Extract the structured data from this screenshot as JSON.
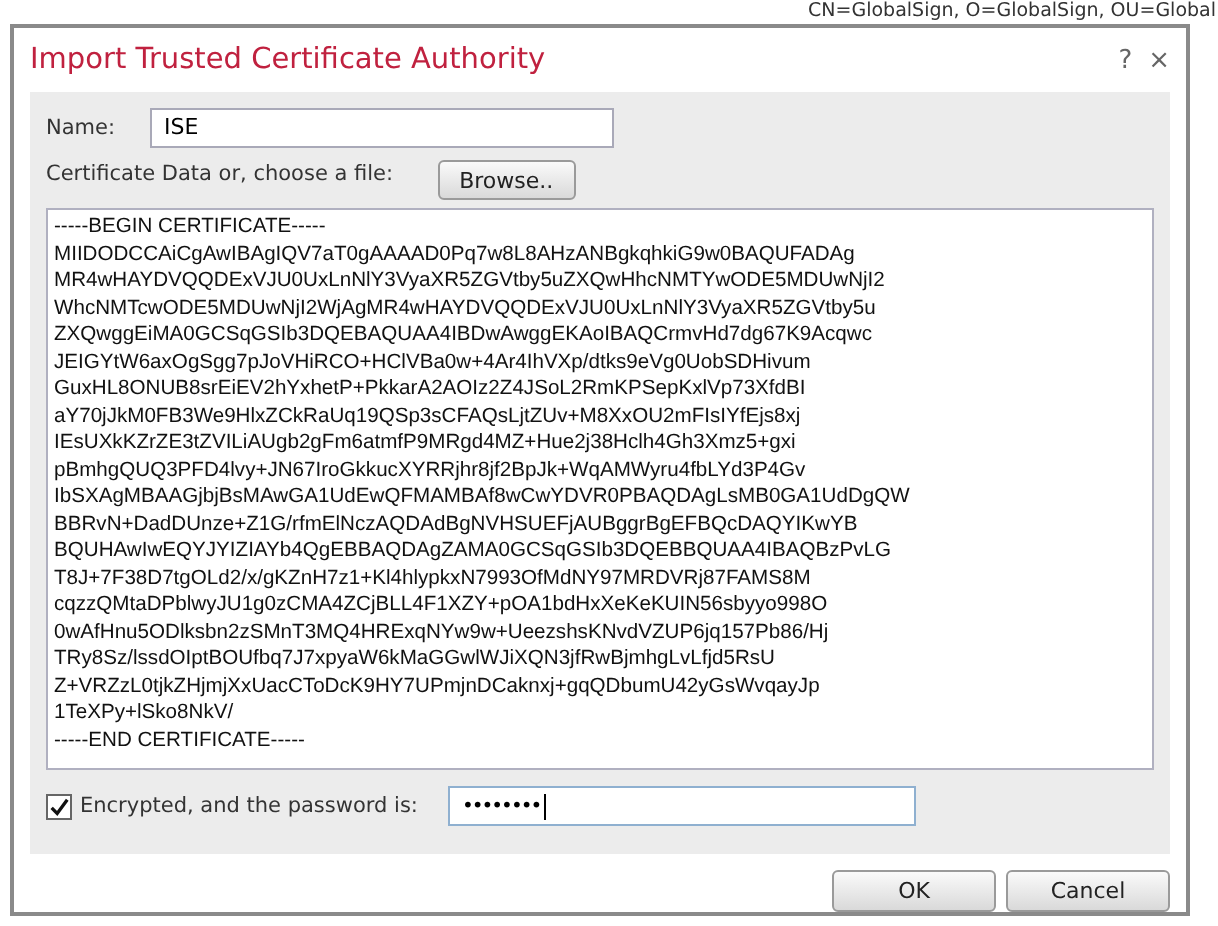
{
  "background": {
    "text": "CN=GlobalSign, O=GlobalSign, OU=Global"
  },
  "dialog": {
    "title": "Import Trusted Certificate Authority",
    "help": "?",
    "close": "×"
  },
  "name_field": {
    "label": "Name:",
    "value": "ISE"
  },
  "certificate": {
    "label": "Certificate Data or, choose a file:",
    "browse_button": "Browse..",
    "lines": [
      "-----BEGIN CERTIFICATE-----",
      "MIIDODCCAiCgAwIBAgIQV7aT0gAAAAD0Pq7w8L8AHzANBgkqhkiG9w0BAQUFADAg",
      "MR4wHAYDVQQDExVJU0UxLnNlY3VyaXR5ZGVtby5uZXQwHhcNMTYwODE5MDUwNjI2",
      "WhcNMTcwODE5MDUwNjI2WjAgMR4wHAYDVQQDExVJU0UxLnNlY3VyaXR5ZGVtby5u",
      "ZXQwggEiMA0GCSqGSIb3DQEBAQUAA4IBDwAwggEKAoIBAQCrmvHd7dg67K9Acqwc",
      "JEIGYtW6axOgSgg7pJoVHiRCO+HClVBa0w+4Ar4IhVXp/dtks9eVg0UobSDHivum",
      "GuxHL8ONUB8srEiEV2hYxhetP+PkkarA2AOIz2Z4JSoL2RmKPSepKxlVp73XfdBI",
      "aY70jJkM0FB3We9HlxZCkRaUq19QSp3sCFAQsLjtZUv+M8XxOU2mFIsIYfEjs8xj",
      "IEsUXkKZrZE3tZVILiAUgb2gFm6atmfP9MRgd4MZ+Hue2j38Hclh4Gh3Xmz5+gxi",
      "pBmhgQUQ3PFD4lvy+JN67IroGkkucXYRRjhr8jf2BpJk+WqAMWyru4fbLYd3P4Gv",
      "IbSXAgMBAAGjbjBsMAwGA1UdEwQFMAMBAf8wCwYDVR0PBAQDAgLsMB0GA1UdDgQW",
      "BBRvN+DadDUnze+Z1G/rfmElNczAQDAdBgNVHSUEFjAUBggrBgEFBQcDAQYIKwYB",
      "BQUHAwIwEQYJYIZIAYb4QgEBBAQDAgZAMA0GCSqGSIb3DQEBBQUAA4IBAQBzPvLG",
      "T8J+7F38D7tgOLd2/x/gKZnH7z1+Kl4hlypkxN7993OfMdNY97MRDVRj87FAMS8M",
      "cqzzQMtaDPblwyJU1g0zCMA4ZCjBLL4F1XZY+pOA1bdHxXeKeKUIN56sbyyo998O",
      "0wAfHnu5ODlksbn2zSMnT3MQ4HRExqNYw9w+UeezshsKNvdVZUP6jq157Pb86/Hj",
      "TRy8Sz/lssdOIptBOUfbq7J7xpyaW6kMaGGwlWJiXQN3jfRwBjmhgLvLfjd5RsU",
      "Z+VRZzL0tjkZHjmjXxUacCToDcK9HY7UPmjnDCaknxj+gqQDbumU42yGsWvqayJp",
      "1TeXPy+lSko8NkV/",
      "-----END CERTIFICATE-----"
    ]
  },
  "encrypted": {
    "label": "Encrypted, and the password is:",
    "checked": true,
    "password": "••••••••"
  },
  "buttons": [
    "OK",
    "Cancel"
  ]
}
